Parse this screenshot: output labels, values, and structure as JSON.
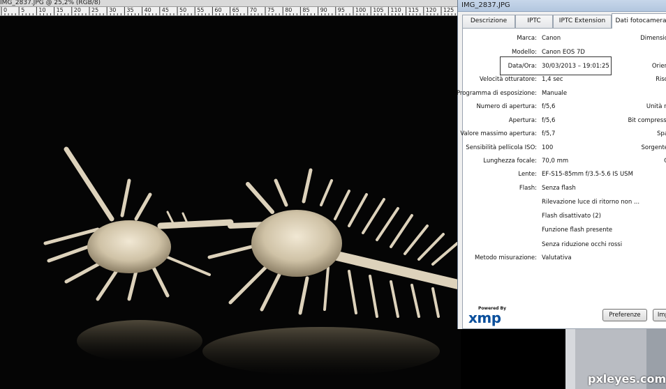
{
  "document": {
    "title": "IMG_2837.JPG @ 25,2% (RGB/8)",
    "ruler_labels": [
      "0",
      "5",
      "10",
      "15",
      "20",
      "25",
      "30",
      "35",
      "40",
      "45",
      "50",
      "55",
      "60",
      "65",
      "70",
      "75",
      "80",
      "85",
      "90",
      "95",
      "100",
      "105",
      "110",
      "115",
      "120",
      "125"
    ]
  },
  "dialog": {
    "title": "IMG_2837.JPG",
    "tabs": [
      {
        "label": "Descrizione"
      },
      {
        "label": "IPTC"
      },
      {
        "label": "IPTC Extension"
      },
      {
        "label": "Dati fotocamera"
      }
    ],
    "fields": [
      {
        "label": "Marca:",
        "value": "Canon"
      },
      {
        "label": "Modello:",
        "value": "Canon EOS 7D"
      },
      {
        "label": "Data/Ora:",
        "value": "30/03/2013 – 19:01:25"
      },
      {
        "label": "Velocità otturatore:",
        "value": "1,4 sec"
      },
      {
        "label": "Programma di esposizione:",
        "value": "Manuale"
      },
      {
        "label": "Numero di apertura:",
        "value": "f/5,6"
      },
      {
        "label": "Apertura:",
        "value": "f/5,6"
      },
      {
        "label": "Valore massimo apertura:",
        "value": "f/5,7"
      },
      {
        "label": "Sensibilità pellicola ISO:",
        "value": "100"
      },
      {
        "label": "Lunghezza focale:",
        "value": "70,0 mm"
      },
      {
        "label": "Lente:",
        "value": "EF-S15-85mm f/3.5-5.6 IS USM"
      },
      {
        "label": "Flash:",
        "value": "Senza flash"
      },
      {
        "label": "",
        "value": "Rilevazione luce di ritorno non ..."
      },
      {
        "label": "",
        "value": "Flash disattivato (2)"
      },
      {
        "label": "",
        "value": "Funzione flash presente"
      },
      {
        "label": "",
        "value": "Senza riduzione occhi rossi"
      },
      {
        "label": "Metodo misurazione:",
        "value": "Valutativa"
      }
    ],
    "right_fields": [
      "Dimensio",
      "Orien",
      "Riso",
      "Unità ri",
      "Bit compressi",
      "Spa",
      "Sorgente",
      "C"
    ],
    "xmp": {
      "powered": "Powered By",
      "logo": "xmp"
    },
    "buttons": {
      "preferences": "Preferenze",
      "import": "Imp"
    }
  },
  "watermark": "pxleyes.com",
  "colors": {
    "accent": "#0a4f9c",
    "canvas": "#050505",
    "shell": "#e6dcc8"
  }
}
